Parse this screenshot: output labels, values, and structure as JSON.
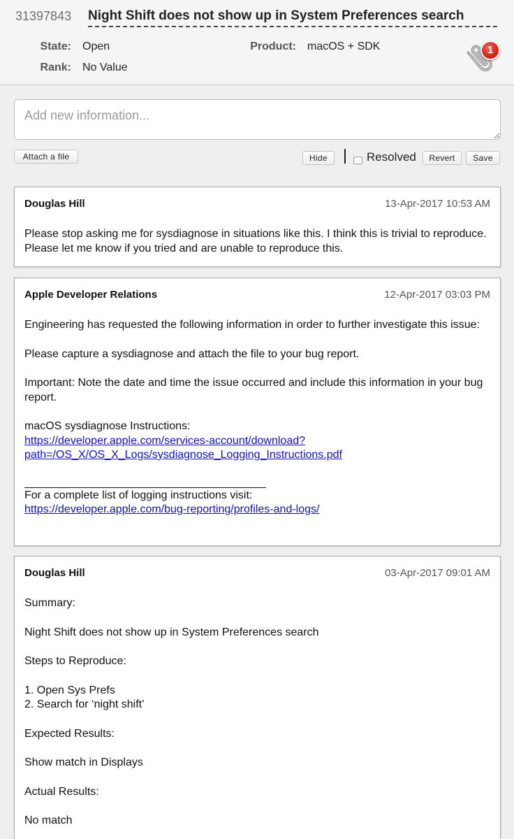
{
  "bug": {
    "id": "31397843",
    "title": "Night Shift does not show up in System Preferences search",
    "state_label": "State:",
    "state_value": "Open",
    "rank_label": "Rank:",
    "rank_value": "No Value",
    "product_label": "Product:",
    "product_value": "macOS + SDK",
    "attachment_count": "1"
  },
  "composer": {
    "placeholder": "Add new information...",
    "attach_label": "Attach a file",
    "hide_label": "Hide",
    "resolved_label": "Resolved",
    "revert_label": "Revert",
    "save_label": "Save"
  },
  "comments": [
    {
      "author": "Douglas Hill",
      "date": "13-Apr-2017 10:53 AM",
      "text": "Please stop asking me for sysdiagnose in situations like this. I think this is trivial to reproduce. Please let me know if you tried and are unable to reproduce this."
    },
    {
      "author": "Apple Developer Relations",
      "date": "12-Apr-2017 03:03 PM",
      "para1": "Engineering has requested the following information in order to further investigate this issue:",
      "para2": "Please capture a sysdiagnose and attach the file to your bug report.",
      "para3": "Important: Note the date and time the issue occurred and include this information in your bug report.",
      "instructions_label": "macOS sysdiagnose Instructions:",
      "link1_line1": "https://developer.apple.com/services-account/download?",
      "link1_line2": "path=/OS_X/OS_X_Logs/sysdiagnose_Logging_Instructions.pdf",
      "complete_list": "For a complete list of logging instructions visit:",
      "link2": "https://developer.apple.com/bug-reporting/profiles-and-logs/"
    },
    {
      "author": "Douglas Hill",
      "date": "03-Apr-2017 09:01 AM",
      "summary_label": "Summary:",
      "summary": "Night Shift does not show up in System Preferences search",
      "steps_label": "Steps to Reproduce:",
      "step1": "1. Open Sys Prefs",
      "step2": "2. Search for ‘night shift’",
      "expected_label": "Expected Results:",
      "expected": "Show match in Displays",
      "actual_label": "Actual Results:",
      "actual": "No match"
    }
  ],
  "colors": {
    "link": "#1010c8",
    "badge": "#d8261a",
    "background": "#efefef"
  }
}
